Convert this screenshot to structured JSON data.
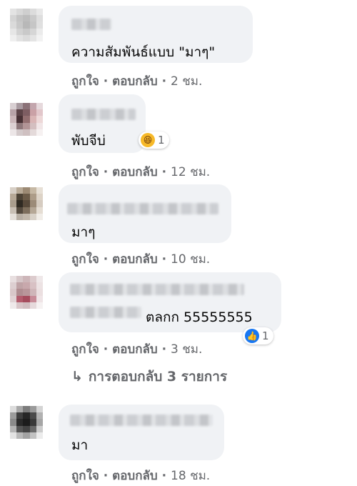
{
  "actions": {
    "like": "ถูกใจ",
    "reply": "ตอบกลับ",
    "sep": "·"
  },
  "comments": [
    {
      "text": "ความสัมพันธ์แบบ \"มาๆ\"",
      "time": "2 ชม."
    },
    {
      "text": "พับจีบ่",
      "time": "12 ชม.",
      "reaction": {
        "icon": "haha-emoji-icon",
        "count": "1"
      }
    },
    {
      "text": "มาๆ",
      "time": "10 ชม."
    },
    {
      "text": "ตลกก 55555555",
      "time": "3 ชม.",
      "reaction": {
        "icon": "like-icon",
        "count": "1"
      }
    },
    {
      "text": "มา",
      "time": "18 ชม."
    }
  ],
  "replies": {
    "label": "การตอบกลับ 3 รายการ"
  },
  "colors": {
    "bubble": "#f0f2f5",
    "meta": "#65676b",
    "like_blue": "#1877f2",
    "haha_yellow": "#f7b928"
  }
}
